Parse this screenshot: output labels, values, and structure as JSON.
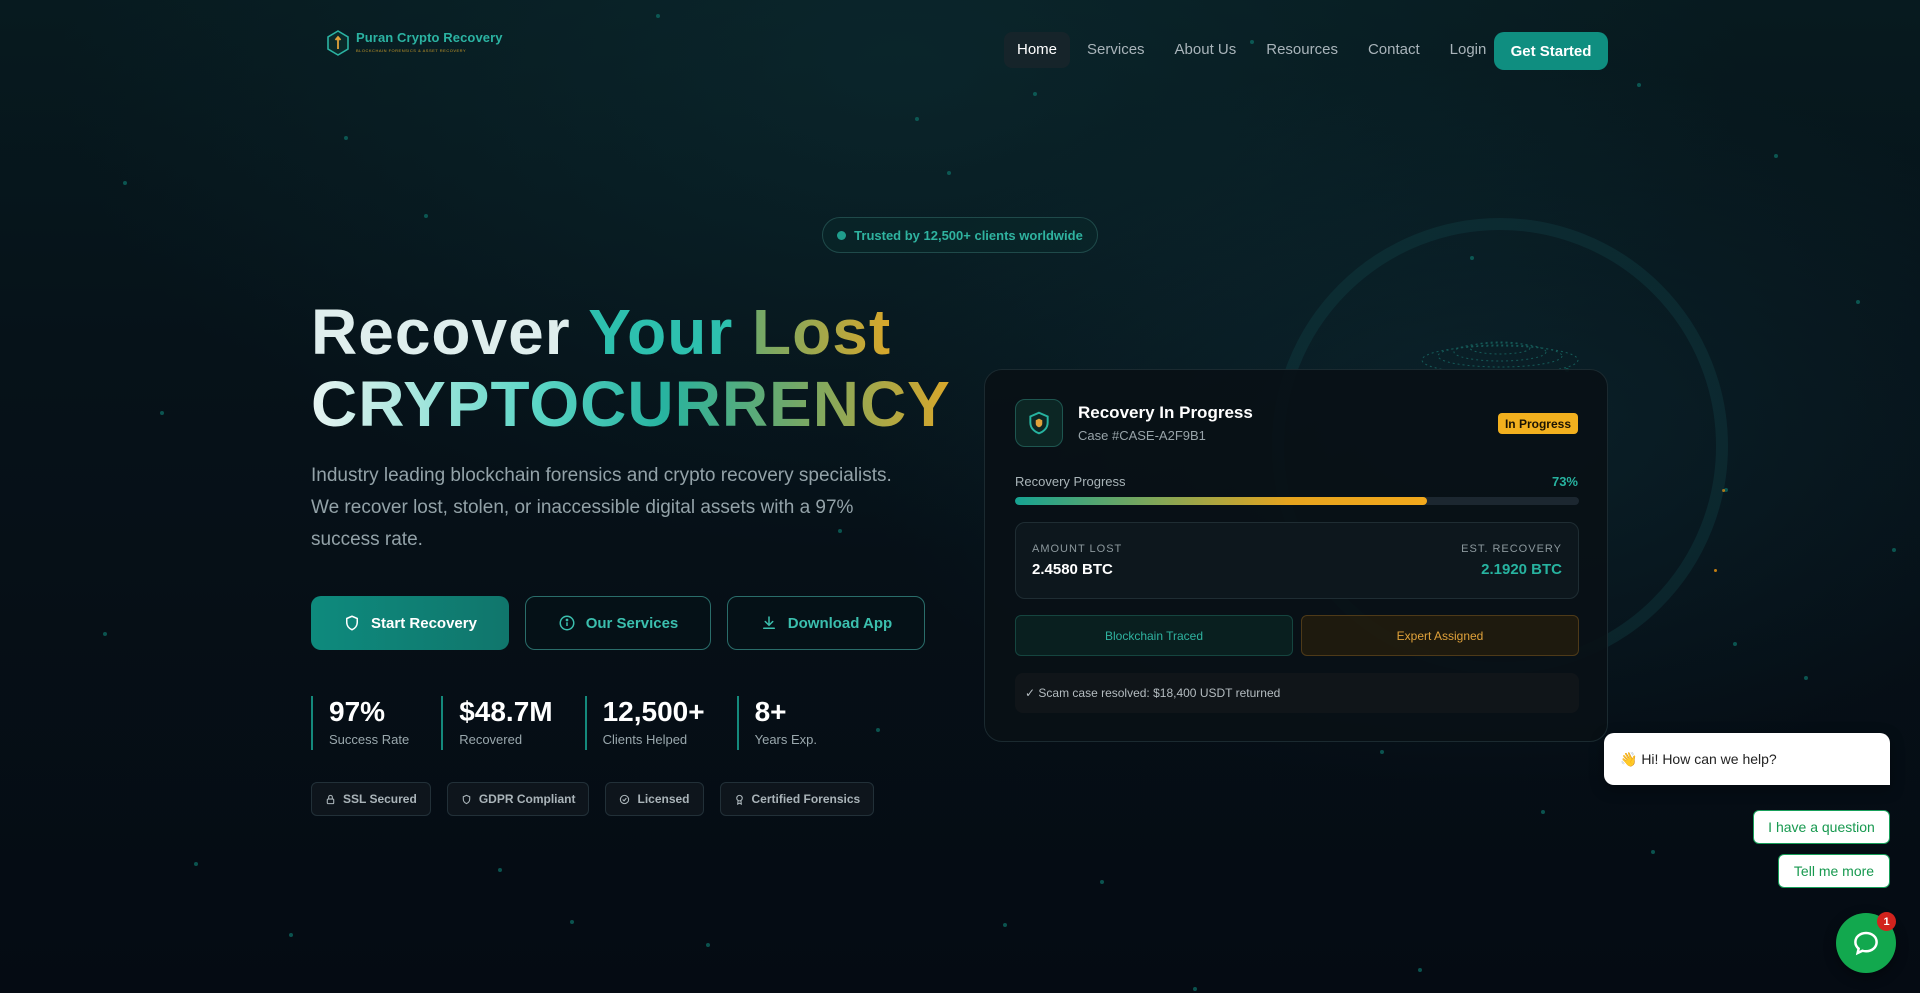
{
  "brand": {
    "name": "Puran Crypto Recovery",
    "tagline": "BLOCKCHAIN FORENSICS & ASSET RECOVERY",
    "accent": "#0f8e80",
    "gold": "#d9a72a"
  },
  "nav": {
    "items": [
      {
        "label": "Home",
        "active": true
      },
      {
        "label": "Services"
      },
      {
        "label": "About Us"
      },
      {
        "label": "Resources"
      },
      {
        "label": "Contact"
      },
      {
        "label": "Login"
      }
    ],
    "cta_label": "Get Started"
  },
  "hero": {
    "trust_badge": "Trusted by 12,500+ clients worldwide",
    "title_word_1": "Recover",
    "title_word_2": "Your",
    "title_word_3": "Lost",
    "title_line_2": "CRYPTOCURRENCY",
    "description": "Industry leading blockchain forensics and crypto recovery specialists. We recover lost, stolen, or inaccessible digital assets with a 97% success rate.",
    "buttons": {
      "start_recovery": "Start Recovery",
      "our_services": "Our Services",
      "download_app": "Download App"
    },
    "stats": [
      {
        "value": "97%",
        "label": "Success Rate"
      },
      {
        "value": "$48.7M",
        "label": "Recovered"
      },
      {
        "value": "12,500+",
        "label": "Clients Helped"
      },
      {
        "value": "8+",
        "label": "Years Exp."
      }
    ],
    "badges": [
      {
        "label": "SSL Secured",
        "icon": "lock-icon"
      },
      {
        "label": "GDPR Compliant",
        "icon": "shield-icon"
      },
      {
        "label": "Licensed",
        "icon": "check-circle-icon"
      },
      {
        "label": "Certified Forensics",
        "icon": "award-icon"
      }
    ]
  },
  "recovery_card": {
    "title": "Recovery In Progress",
    "case": "Case #CASE-A2F9B1",
    "status": "In Progress",
    "progress_label": "Recovery Progress",
    "progress_text": "73%",
    "progress": 0.73,
    "amount_lost_label": "AMOUNT LOST",
    "amount_lost_value": "2.4580 BTC",
    "est_recovery_label": "EST. RECOVERY",
    "est_recovery_value": "2.1920 BTC",
    "step_traced": "Blockchain Traced",
    "step_expert": "Expert Assigned",
    "resolved_note": "✓ Scam case resolved: $18,400 USDT returned"
  },
  "chat": {
    "greeting": "👋 Hi! How can we help?",
    "replies": [
      "I have a question",
      "Tell me more"
    ],
    "unread_count": "1"
  }
}
